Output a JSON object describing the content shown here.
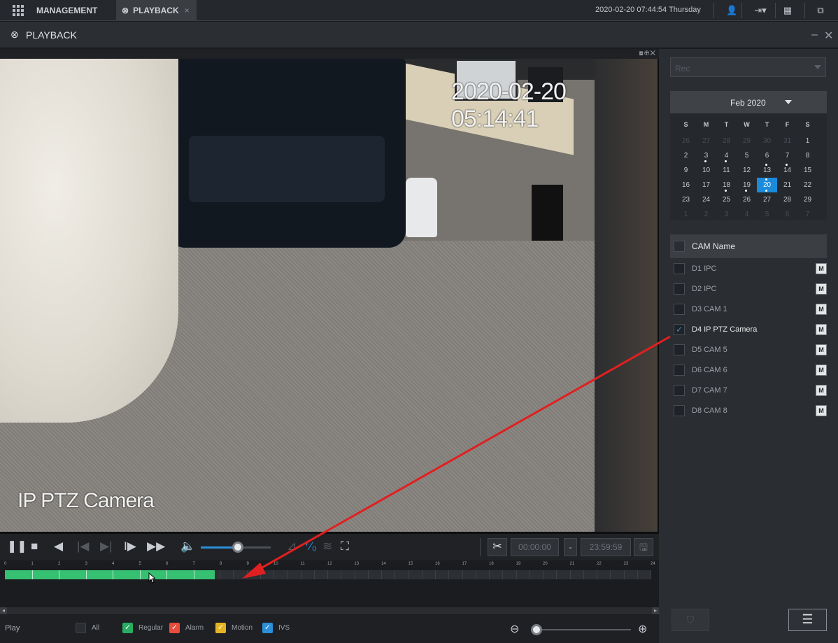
{
  "topbar": {
    "tab_management": "MANAGEMENT",
    "tab_playback": "PLAYBACK",
    "tab_close": "×",
    "datetime": "2020-02-20 07:44:54 Thursday"
  },
  "titlebar": {
    "title": "PLAYBACK",
    "minimize": "–",
    "close": "✕"
  },
  "video": {
    "osd_time": "2020-02-20 05:14:41",
    "osd_name": "IP PTZ Camera"
  },
  "controls": {
    "clip_start": "00:00:00",
    "clip_dash": "-",
    "clip_end": "23:59:59",
    "volume_level": 0.53
  },
  "timeline": {
    "hours": [
      "0",
      "1",
      "2",
      "3",
      "4",
      "5",
      "6",
      "7",
      "8",
      "9",
      "10",
      "11",
      "12",
      "13",
      "14",
      "15",
      "16",
      "17",
      "18",
      "19",
      "20",
      "21",
      "22",
      "23",
      "24"
    ],
    "recorded_until_hour": 7.8,
    "recording_color": "#35c072"
  },
  "bottombar": {
    "play_label": "Play",
    "legend": [
      {
        "label": "All",
        "color": "#2a2d31",
        "checked": false
      },
      {
        "label": "Regular",
        "color": "#27ae60",
        "checked": true
      },
      {
        "label": "Alarm",
        "color": "#e74c3c",
        "checked": true
      },
      {
        "label": "Motion",
        "color": "#e6b422",
        "checked": true
      },
      {
        "label": "IVS",
        "color": "#2b8fd9",
        "checked": true
      }
    ]
  },
  "rpanel": {
    "select_value": "Rec",
    "calendar_month": "Feb 2020",
    "weekdays": [
      "S",
      "M",
      "T",
      "W",
      "T",
      "F",
      "S"
    ],
    "weeks": [
      [
        {
          "d": "26",
          "o": true
        },
        {
          "d": "27",
          "o": true
        },
        {
          "d": "28",
          "o": true
        },
        {
          "d": "29",
          "o": true
        },
        {
          "d": "30",
          "o": true
        },
        {
          "d": "31",
          "o": true
        },
        {
          "d": "1"
        }
      ],
      [
        {
          "d": "2"
        },
        {
          "d": "3",
          "dot": true
        },
        {
          "d": "4",
          "dot": true
        },
        {
          "d": "5"
        },
        {
          "d": "6"
        },
        {
          "d": "7"
        },
        {
          "d": "8"
        }
      ],
      [
        {
          "d": "9"
        },
        {
          "d": "10"
        },
        {
          "d": "11"
        },
        {
          "d": "12"
        },
        {
          "d": "13",
          "dot": true
        },
        {
          "d": "14",
          "dot": true
        },
        {
          "d": "15"
        }
      ],
      [
        {
          "d": "16"
        },
        {
          "d": "17"
        },
        {
          "d": "18",
          "dot": true
        },
        {
          "d": "19",
          "dot": true
        },
        {
          "d": "20",
          "sel": true,
          "dot": true
        },
        {
          "d": "21"
        },
        {
          "d": "22"
        }
      ],
      [
        {
          "d": "23"
        },
        {
          "d": "24"
        },
        {
          "d": "25"
        },
        {
          "d": "26"
        },
        {
          "d": "27"
        },
        {
          "d": "28"
        },
        {
          "d": "29"
        }
      ],
      [
        {
          "d": "1",
          "o": true
        },
        {
          "d": "2",
          "o": true
        },
        {
          "d": "3",
          "o": true
        },
        {
          "d": "4",
          "o": true
        },
        {
          "d": "5",
          "o": true
        },
        {
          "d": "6",
          "o": true
        },
        {
          "d": "7",
          "o": true
        }
      ]
    ],
    "cam_header": "CAM Name",
    "cameras": [
      {
        "name": "D1 IPC",
        "checked": false
      },
      {
        "name": "D2 IPC",
        "checked": false
      },
      {
        "name": "D3 CAM 1",
        "checked": false
      },
      {
        "name": "D4 IP PTZ Camera",
        "checked": true
      },
      {
        "name": "D5 CAM 5",
        "checked": false
      },
      {
        "name": "D6 CAM 6",
        "checked": false
      },
      {
        "name": "D7 CAM 7",
        "checked": false
      },
      {
        "name": "D8 CAM 8",
        "checked": false
      }
    ],
    "m_label": "M"
  },
  "accent_color": "#1c8adb",
  "annotation_color": "#e02020"
}
